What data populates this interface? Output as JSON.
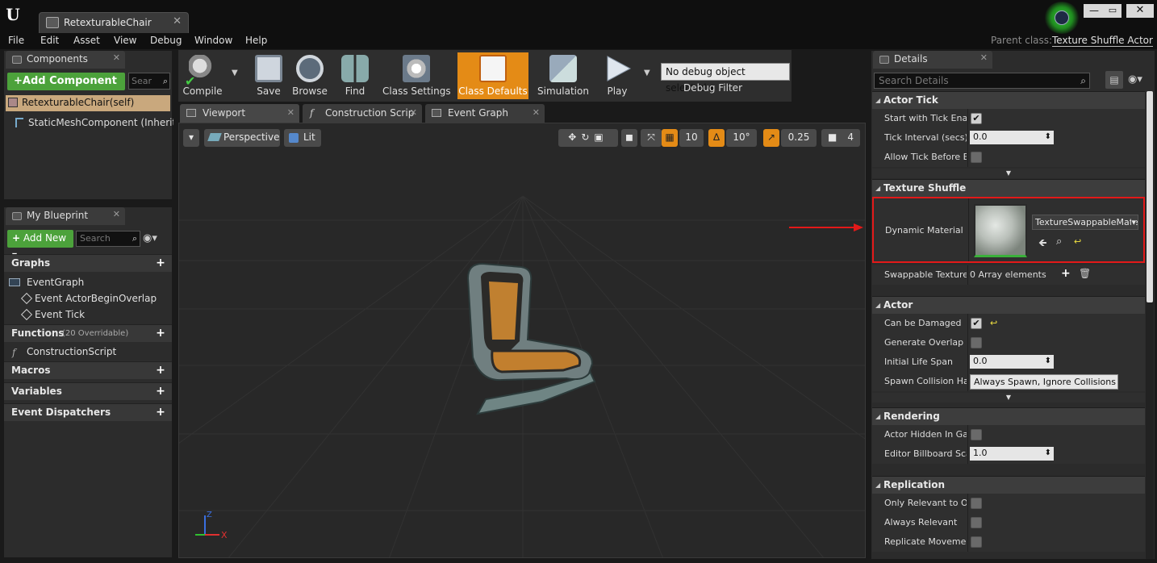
{
  "window": {
    "tab_title": "RetexturableChair"
  },
  "menu": [
    "File",
    "Edit",
    "Asset",
    "View",
    "Debug",
    "Window",
    "Help"
  ],
  "parent_class": {
    "label": "Parent class:",
    "value": "Texture Shuffle Actor"
  },
  "components": {
    "tab": "Components",
    "add_label": "+Add Component",
    "search_placeholder": "Sear",
    "root": "RetexturableChair(self)",
    "child": "StaticMeshComponent (Inherited"
  },
  "blueprint": {
    "tab": "My Blueprint",
    "add_label": "Add New",
    "search_placeholder": "Search",
    "graphs_label": "Graphs",
    "event_graph": "EventGraph",
    "events": [
      "Event ActorBeginOverlap",
      "Event Tick"
    ],
    "functions_label": "Functions",
    "functions_sub": "(20 Overridable)",
    "construction_script": "ConstructionScript",
    "macros_label": "Macros",
    "variables_label": "Variables",
    "dispatchers_label": "Event Dispatchers"
  },
  "toolbar": {
    "compile": "Compile",
    "save": "Save",
    "browse": "Browse",
    "find": "Find",
    "class_settings": "Class Settings",
    "class_defaults": "Class Defaults",
    "simulation": "Simulation",
    "play": "Play",
    "debug_select": "No debug object selected",
    "debug_filter": "Debug Filter"
  },
  "view_tabs": [
    "Viewport",
    "Construction Scrip",
    "Event Graph"
  ],
  "viewport": {
    "perspective": "Perspective",
    "lit": "Lit",
    "grid_snap": "10",
    "rot_snap": "10°",
    "scale_snap": "0.25",
    "cam_speed": "4",
    "axis_x": "X",
    "axis_z": "Z"
  },
  "details": {
    "tab": "Details",
    "search_placeholder": "Search Details",
    "actor_tick": {
      "title": "Actor Tick",
      "start_with_tick": "Start with Tick Enab",
      "tick_interval": "Tick Interval (secs)",
      "tick_interval_value": "0.0",
      "allow_tick": "Allow Tick Before Be"
    },
    "texture_shuffle": {
      "title": "Texture Shuffle",
      "dynamic_material": "Dynamic Material",
      "material_value": "TextureSwappableMate",
      "swappable_textures": "Swappable Textures",
      "swappable_value": "0 Array elements"
    },
    "actor": {
      "title": "Actor",
      "can_be_damaged": "Can be Damaged",
      "generate_overlap": "Generate Overlap Ev",
      "initial_life_span": "Initial Life Span",
      "life_span_value": "0.0",
      "spawn_collision": "Spawn Collision Han",
      "spawn_collision_value": "Always Spawn, Ignore Collisions"
    },
    "rendering": {
      "title": "Rendering",
      "hidden_in_game": "Actor Hidden In Gam",
      "billboard_scale": "Editor Billboard Scal",
      "billboard_value": "1.0"
    },
    "replication": {
      "title": "Replication",
      "only_relevant": "Only Relevant to Ow",
      "always_relevant": "Always Relevant",
      "replicate_movement": "Replicate Movemen"
    }
  },
  "colors": {
    "accent_green": "#4ca23b",
    "active_orange": "#e48b16",
    "highlight_red": "#e31919"
  }
}
